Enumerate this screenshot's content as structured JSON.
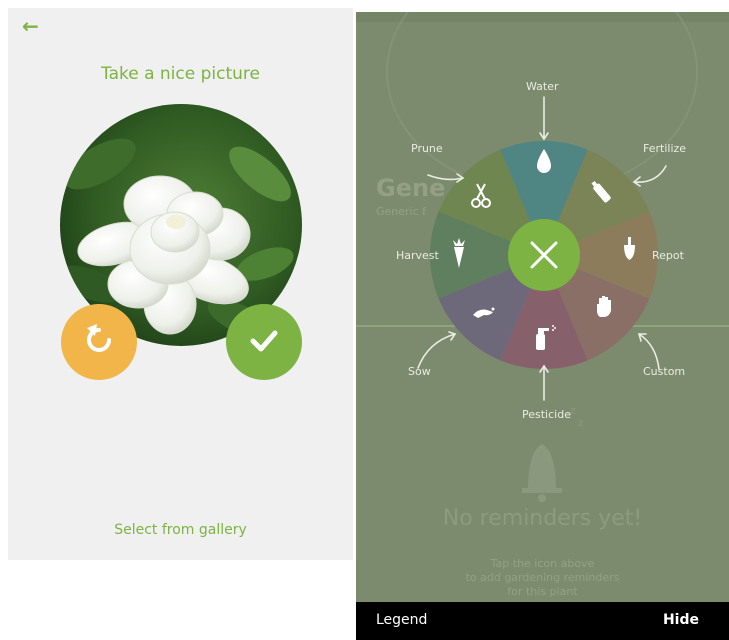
{
  "camera": {
    "title": "Take a nice picture",
    "gallery_label": "Select from gallery"
  },
  "background": {
    "plant_title": "Gene",
    "plant_subtitle": "Generic f",
    "empty_title": "No reminders yet!",
    "hint_line1": "Tap the icon above",
    "hint_line2": "to add gardening reminders",
    "hint_line3": "for this plant"
  },
  "wheel": {
    "labels": {
      "water": "Water",
      "fertilize": "Fertilize",
      "repot": "Repot",
      "custom": "Custom",
      "pesticide": "Pesticide",
      "sow": "Sow",
      "harvest": "Harvest",
      "prune": "Prune"
    },
    "colors": {
      "water": "#4f8583",
      "fertilize": "#7b8456",
      "repot": "#8d7c5c",
      "custom": "#8a6f67",
      "pesticide": "#86616b",
      "sow": "#6d697a",
      "harvest": "#607f5e",
      "prune": "#6f8651",
      "center": "#7cb342"
    }
  },
  "bottom": {
    "legend_label": "Legend",
    "hide_label": "Hide"
  },
  "colors": {
    "accent": "#7cb342",
    "retake": "#f1b54a"
  }
}
